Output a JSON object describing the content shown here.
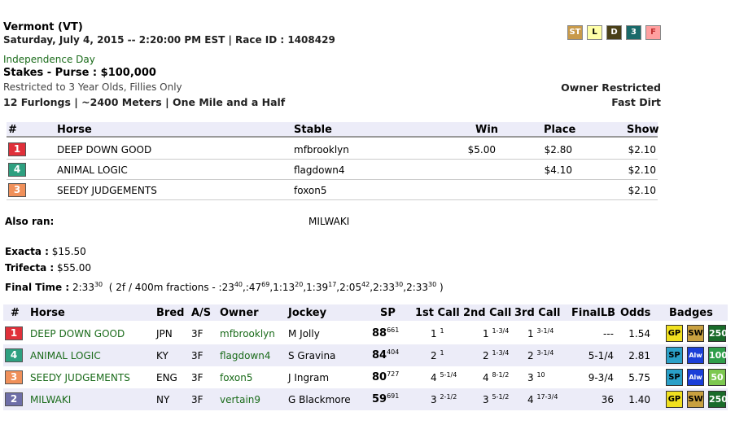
{
  "header": {
    "track": "Vermont (VT)",
    "date_line": "Saturday, July 4, 2015 -- 2:20:00 PM EST | Race ID : 1408429",
    "race_name": "Independence Day",
    "stakes_prefix": "Stakes - Purse : ",
    "purse": "$100,000",
    "restriction": "Restricted to 3 Year Olds, Fillies Only",
    "distance": "12 Furlongs | ~2400 Meters | One Mile and a Half",
    "owner_restricted": "Owner Restricted",
    "surface": "Fast Dirt"
  },
  "surface_legend": [
    {
      "label": "ST",
      "bg": "#c89a4a",
      "fg": "#ffffff"
    },
    {
      "label": "L",
      "bg": "#ffffa8",
      "fg": "#000000"
    },
    {
      "label": "D",
      "bg": "#4a4018",
      "fg": "#ffffff"
    },
    {
      "label": "3",
      "bg": "#1a6a6a",
      "fg": "#ffffff"
    },
    {
      "label": "F",
      "bg": "#ffa0a0",
      "fg": "#c03030"
    }
  ],
  "results": {
    "headers": {
      "num": "#",
      "horse": "Horse",
      "stable": "Stable",
      "win": "Win",
      "place": "Place",
      "show": "Show"
    },
    "rows": [
      {
        "pp": "1",
        "horse": "DEEP DOWN GOOD",
        "stable": "mfbrooklyn",
        "win": "$5.00",
        "place": "$2.80",
        "show": "$2.10"
      },
      {
        "pp": "4",
        "horse": "ANIMAL LOGIC",
        "stable": "flagdown4",
        "win": "",
        "place": "$4.10",
        "show": "$2.10"
      },
      {
        "pp": "3",
        "horse": "SEEDY JUDGEMENTS",
        "stable": "foxon5",
        "win": "",
        "place": "",
        "show": "$2.10"
      }
    ]
  },
  "also_ran": {
    "label": "Also ran:",
    "value": "MILWAKI"
  },
  "exotics": {
    "exacta_label": "Exacta :",
    "exacta_value": "$15.50",
    "trifecta_label": "Trifecta :",
    "trifecta_value": "$55.00"
  },
  "final_time": {
    "label": "Final Time :",
    "time": "2:33",
    "time_sup": "30",
    "fractions_open": "( 2f / 400m fractions - ",
    "fractions": [
      {
        "t": ":23",
        "s": "40"
      },
      {
        "t": ":47",
        "s": "69"
      },
      {
        "t": "1:13",
        "s": "20"
      },
      {
        "t": "1:39",
        "s": "17"
      },
      {
        "t": "2:05",
        "s": "42"
      },
      {
        "t": "2:33",
        "s": "30"
      },
      {
        "t": "2:33",
        "s": "30"
      }
    ],
    "fractions_close": " )"
  },
  "entries": {
    "headers": {
      "num": "#",
      "horse": "Horse",
      "bred": "Bred",
      "as": "A/S",
      "owner": "Owner",
      "jockey": "Jockey",
      "sp": "SP",
      "call1": "1st Call",
      "call2": "2nd Call",
      "call3": "3rd Call",
      "finallb": "FinalLB",
      "odds": "Odds",
      "badges": "Badges"
    },
    "rows": [
      {
        "pp": "1",
        "horse": "DEEP DOWN GOOD",
        "bred": "JPN",
        "as": "3F",
        "owner": "mfbrooklyn",
        "jockey": "M Jolly",
        "sp": "88",
        "sp_sup": "661",
        "c1": "1",
        "c1s": "1",
        "c2": "1",
        "c2s": "1-3/4",
        "c3": "1",
        "c3s": "3-1/4",
        "finallb": "---",
        "odds": "1.54",
        "badges": [
          "GP",
          "SW",
          "250"
        ]
      },
      {
        "pp": "4",
        "horse": "ANIMAL LOGIC",
        "bred": "KY",
        "as": "3F",
        "owner": "flagdown4",
        "jockey": "S Gravina",
        "sp": "84",
        "sp_sup": "404",
        "c1": "2",
        "c1s": "1",
        "c2": "2",
        "c2s": "1-3/4",
        "c3": "2",
        "c3s": "3-1/4",
        "finallb": "5-1/4",
        "odds": "2.81",
        "badges": [
          "SP",
          "Alw",
          "100"
        ]
      },
      {
        "pp": "3",
        "horse": "SEEDY JUDGEMENTS",
        "bred": "ENG",
        "as": "3F",
        "owner": "foxon5",
        "jockey": "J Ingram",
        "sp": "80",
        "sp_sup": "727",
        "c1": "4",
        "c1s": "5-1/4",
        "c2": "4",
        "c2s": "8-1/2",
        "c3": "3",
        "c3s": "10",
        "finallb": "9-3/4",
        "odds": "5.75",
        "badges": [
          "SP",
          "Alw",
          "50"
        ]
      },
      {
        "pp": "2",
        "horse": "MILWAKI",
        "bred": "NY",
        "as": "3F",
        "owner": "vertain9",
        "jockey": "G Blackmore",
        "sp": "59",
        "sp_sup": "691",
        "c1": "3",
        "c1s": "2-1/2",
        "c2": "3",
        "c2s": "5-1/2",
        "c3": "4",
        "c3s": "17-3/4",
        "finallb": "36",
        "odds": "1.40",
        "badges": [
          "GP",
          "SW",
          "250"
        ]
      }
    ]
  },
  "icons": {
    "GP": "graded-purse-badge-icon",
    "SP": "stakes-purse-badge-icon",
    "SW": "stakes-winner-badge-icon",
    "Alw": "allowance-badge-icon",
    "250": "points-250-badge-icon",
    "100": "points-100-badge-icon",
    "50": "points-50-badge-icon"
  }
}
